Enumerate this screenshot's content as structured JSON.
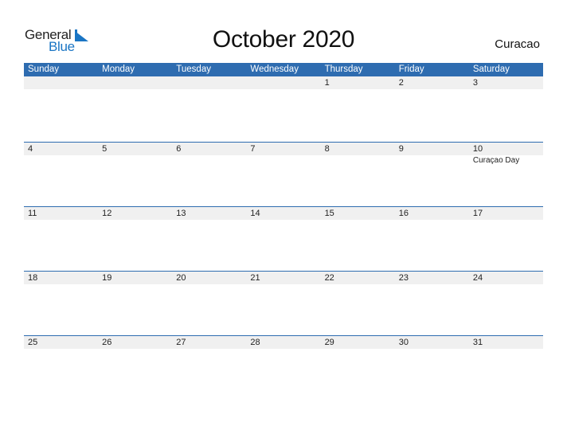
{
  "logo": {
    "general": "General",
    "blue": "Blue",
    "icon": "triangle-flag-icon"
  },
  "title": "October 2020",
  "country": "Curacao",
  "colors": {
    "header_bg": "#2e6cb0",
    "date_strip_bg": "#f0f0f0",
    "logo_blue": "#1a75c4"
  },
  "weekdays": [
    "Sunday",
    "Monday",
    "Tuesday",
    "Wednesday",
    "Thursday",
    "Friday",
    "Saturday"
  ],
  "weeks": [
    {
      "days": [
        "",
        "",
        "",
        "",
        "1",
        "2",
        "3"
      ],
      "events": [
        "",
        "",
        "",
        "",
        "",
        "",
        ""
      ]
    },
    {
      "days": [
        "4",
        "5",
        "6",
        "7",
        "8",
        "9",
        "10"
      ],
      "events": [
        "",
        "",
        "",
        "",
        "",
        "",
        "Curaçao Day"
      ]
    },
    {
      "days": [
        "11",
        "12",
        "13",
        "14",
        "15",
        "16",
        "17"
      ],
      "events": [
        "",
        "",
        "",
        "",
        "",
        "",
        ""
      ]
    },
    {
      "days": [
        "18",
        "19",
        "20",
        "21",
        "22",
        "23",
        "24"
      ],
      "events": [
        "",
        "",
        "",
        "",
        "",
        "",
        ""
      ]
    },
    {
      "days": [
        "25",
        "26",
        "27",
        "28",
        "29",
        "30",
        "31"
      ],
      "events": [
        "",
        "",
        "",
        "",
        "",
        "",
        ""
      ]
    }
  ]
}
